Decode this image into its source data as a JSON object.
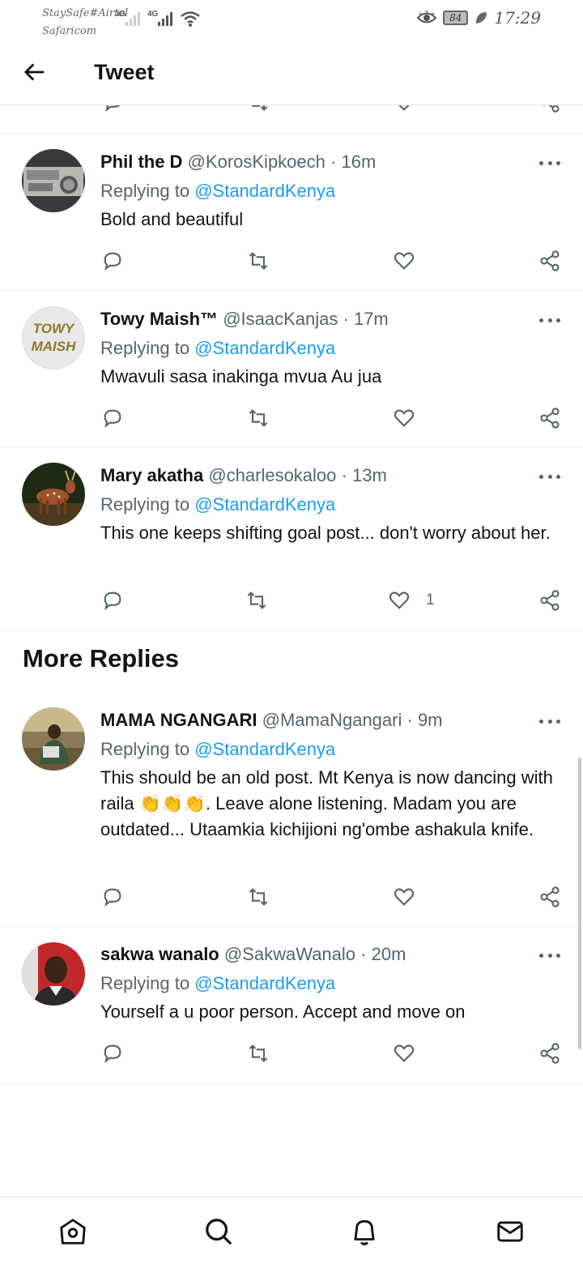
{
  "status_bar": {
    "carrier_line1": "StaySafe#Airtel",
    "carrier_line2": "Safaricom",
    "network_1": "3G",
    "network_2": "4G",
    "battery": "84",
    "time": "17:29"
  },
  "header": {
    "title": "Tweet",
    "back_icon": "back-arrow-icon"
  },
  "replies": [
    {
      "name": "Phil the D",
      "handle": "@KorosKipkoech",
      "time": "16m",
      "replying_prefix": "Replying to",
      "replying_to": "@StandardKenya",
      "text": "Bold and beautiful",
      "likes": ""
    },
    {
      "name": "Towy Maish™",
      "handle": "@IsaacKanjas",
      "time": "17m",
      "replying_prefix": "Replying to",
      "replying_to": "@StandardKenya",
      "text": "Mwavuli sasa inakinga mvua Au jua",
      "likes": "",
      "avatar_text_1": "TOWY",
      "avatar_text_2": "MAISH"
    },
    {
      "name": "Mary akatha",
      "handle": "@charlesokaloo",
      "time": "13m",
      "replying_prefix": "Replying to",
      "replying_to": "@StandardKenya",
      "text": "This one keeps shifting goal post... don't worry about her.",
      "likes": "1"
    }
  ],
  "more_replies": {
    "title": "More Replies",
    "items": [
      {
        "name": "MAMA NGANGARI",
        "handle": "@MamaNgangari",
        "time": "9m",
        "replying_prefix": "Replying to",
        "replying_to": "@StandardKenya",
        "text_part1": "This should be an old post. Mt Kenya is now dancing with raila ",
        "emoji": "👏👏👏",
        "text_part2": ". Leave alone listening. Madam you are outdated... Utaamkia kichijioni ng'ombe ashakula knife.",
        "likes": ""
      },
      {
        "name": "sakwa wanalo",
        "handle": "@SakwaWanalo",
        "time": "20m",
        "replying_prefix": "Replying to",
        "replying_to": "@StandardKenya",
        "text": "Yourself a u poor person. Accept and move on",
        "likes": ""
      }
    ]
  },
  "separator": "·",
  "colors": {
    "accent": "#1d9bf0",
    "secondary_text": "#536471",
    "primary_text": "#0f1419"
  },
  "bottom_nav": [
    "home-icon",
    "search-icon",
    "notifications-icon",
    "messages-icon"
  ]
}
